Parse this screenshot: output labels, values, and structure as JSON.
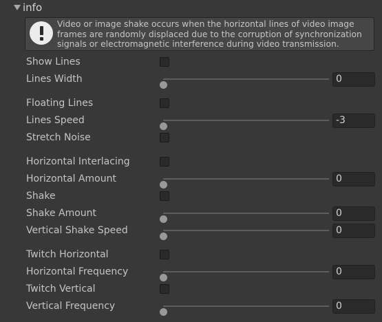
{
  "foldout": {
    "label": "info",
    "expanded": true
  },
  "help": {
    "icon": "warning-icon",
    "text": "Video or image shake occurs when the horizontal lines of video image frames are randomly displaced due to the corruption of synchronization signals or electromagnetic interference during video transmission."
  },
  "fields": [
    {
      "label": "Show Lines",
      "type": "toggle",
      "checked": false
    },
    {
      "label": "Lines Width",
      "type": "slider",
      "value": "0",
      "fraction": 0
    },
    {
      "label": "Floating Lines",
      "type": "toggle",
      "checked": false
    },
    {
      "label": "Lines Speed",
      "type": "slider",
      "value": "-3",
      "fraction": 0
    },
    {
      "label": "Stretch Noise",
      "type": "toggle",
      "checked": false
    },
    {
      "label": "Horizontal Interlacing",
      "type": "toggle",
      "checked": false
    },
    {
      "label": "Horizontal Amount",
      "type": "slider",
      "value": "0",
      "fraction": 0
    },
    {
      "label": "Shake",
      "type": "toggle",
      "checked": false
    },
    {
      "label": "Shake Amount",
      "type": "slider",
      "value": "0",
      "fraction": 0
    },
    {
      "label": "Vertical Shake Speed",
      "type": "slider",
      "value": "0",
      "fraction": 0
    },
    {
      "label": "Twitch Horizontal",
      "type": "toggle",
      "checked": false
    },
    {
      "label": "Horizontal Frequency",
      "type": "slider",
      "value": "0",
      "fraction": 0
    },
    {
      "label": "Twitch Vertical",
      "type": "toggle",
      "checked": false
    },
    {
      "label": "Vertical Frequency",
      "type": "slider",
      "value": "0",
      "fraction": 0
    }
  ],
  "colors": {
    "background": "#383838",
    "text": "#c4c4c4",
    "field_background": "#2a2a2a",
    "slider_thumb": "#999999",
    "slider_track": "#5e5e5e"
  }
}
